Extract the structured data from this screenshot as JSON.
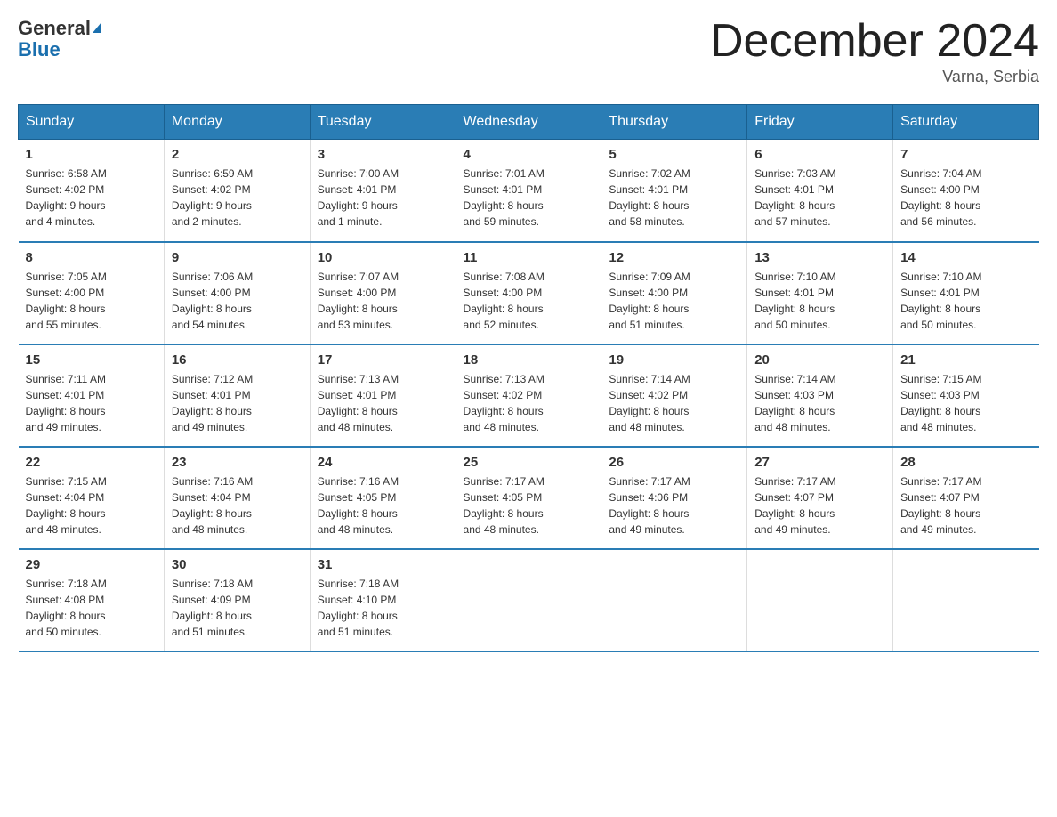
{
  "header": {
    "logo_general": "General",
    "logo_blue": "Blue",
    "month_title": "December 2024",
    "location": "Varna, Serbia"
  },
  "weekdays": [
    "Sunday",
    "Monday",
    "Tuesday",
    "Wednesday",
    "Thursday",
    "Friday",
    "Saturday"
  ],
  "weeks": [
    [
      {
        "day": "1",
        "sunrise": "6:58 AM",
        "sunset": "4:02 PM",
        "daylight": "9 hours and 4 minutes."
      },
      {
        "day": "2",
        "sunrise": "6:59 AM",
        "sunset": "4:02 PM",
        "daylight": "9 hours and 2 minutes."
      },
      {
        "day": "3",
        "sunrise": "7:00 AM",
        "sunset": "4:01 PM",
        "daylight": "9 hours and 1 minute."
      },
      {
        "day": "4",
        "sunrise": "7:01 AM",
        "sunset": "4:01 PM",
        "daylight": "8 hours and 59 minutes."
      },
      {
        "day": "5",
        "sunrise": "7:02 AM",
        "sunset": "4:01 PM",
        "daylight": "8 hours and 58 minutes."
      },
      {
        "day": "6",
        "sunrise": "7:03 AM",
        "sunset": "4:01 PM",
        "daylight": "8 hours and 57 minutes."
      },
      {
        "day": "7",
        "sunrise": "7:04 AM",
        "sunset": "4:00 PM",
        "daylight": "8 hours and 56 minutes."
      }
    ],
    [
      {
        "day": "8",
        "sunrise": "7:05 AM",
        "sunset": "4:00 PM",
        "daylight": "8 hours and 55 minutes."
      },
      {
        "day": "9",
        "sunrise": "7:06 AM",
        "sunset": "4:00 PM",
        "daylight": "8 hours and 54 minutes."
      },
      {
        "day": "10",
        "sunrise": "7:07 AM",
        "sunset": "4:00 PM",
        "daylight": "8 hours and 53 minutes."
      },
      {
        "day": "11",
        "sunrise": "7:08 AM",
        "sunset": "4:00 PM",
        "daylight": "8 hours and 52 minutes."
      },
      {
        "day": "12",
        "sunrise": "7:09 AM",
        "sunset": "4:00 PM",
        "daylight": "8 hours and 51 minutes."
      },
      {
        "day": "13",
        "sunrise": "7:10 AM",
        "sunset": "4:01 PM",
        "daylight": "8 hours and 50 minutes."
      },
      {
        "day": "14",
        "sunrise": "7:10 AM",
        "sunset": "4:01 PM",
        "daylight": "8 hours and 50 minutes."
      }
    ],
    [
      {
        "day": "15",
        "sunrise": "7:11 AM",
        "sunset": "4:01 PM",
        "daylight": "8 hours and 49 minutes."
      },
      {
        "day": "16",
        "sunrise": "7:12 AM",
        "sunset": "4:01 PM",
        "daylight": "8 hours and 49 minutes."
      },
      {
        "day": "17",
        "sunrise": "7:13 AM",
        "sunset": "4:01 PM",
        "daylight": "8 hours and 48 minutes."
      },
      {
        "day": "18",
        "sunrise": "7:13 AM",
        "sunset": "4:02 PM",
        "daylight": "8 hours and 48 minutes."
      },
      {
        "day": "19",
        "sunrise": "7:14 AM",
        "sunset": "4:02 PM",
        "daylight": "8 hours and 48 minutes."
      },
      {
        "day": "20",
        "sunrise": "7:14 AM",
        "sunset": "4:03 PM",
        "daylight": "8 hours and 48 minutes."
      },
      {
        "day": "21",
        "sunrise": "7:15 AM",
        "sunset": "4:03 PM",
        "daylight": "8 hours and 48 minutes."
      }
    ],
    [
      {
        "day": "22",
        "sunrise": "7:15 AM",
        "sunset": "4:04 PM",
        "daylight": "8 hours and 48 minutes."
      },
      {
        "day": "23",
        "sunrise": "7:16 AM",
        "sunset": "4:04 PM",
        "daylight": "8 hours and 48 minutes."
      },
      {
        "day": "24",
        "sunrise": "7:16 AM",
        "sunset": "4:05 PM",
        "daylight": "8 hours and 48 minutes."
      },
      {
        "day": "25",
        "sunrise": "7:17 AM",
        "sunset": "4:05 PM",
        "daylight": "8 hours and 48 minutes."
      },
      {
        "day": "26",
        "sunrise": "7:17 AM",
        "sunset": "4:06 PM",
        "daylight": "8 hours and 49 minutes."
      },
      {
        "day": "27",
        "sunrise": "7:17 AM",
        "sunset": "4:07 PM",
        "daylight": "8 hours and 49 minutes."
      },
      {
        "day": "28",
        "sunrise": "7:17 AM",
        "sunset": "4:07 PM",
        "daylight": "8 hours and 49 minutes."
      }
    ],
    [
      {
        "day": "29",
        "sunrise": "7:18 AM",
        "sunset": "4:08 PM",
        "daylight": "8 hours and 50 minutes."
      },
      {
        "day": "30",
        "sunrise": "7:18 AM",
        "sunset": "4:09 PM",
        "daylight": "8 hours and 51 minutes."
      },
      {
        "day": "31",
        "sunrise": "7:18 AM",
        "sunset": "4:10 PM",
        "daylight": "8 hours and 51 minutes."
      },
      null,
      null,
      null,
      null
    ]
  ],
  "labels": {
    "sunrise": "Sunrise:",
    "sunset": "Sunset:",
    "daylight": "Daylight:"
  }
}
